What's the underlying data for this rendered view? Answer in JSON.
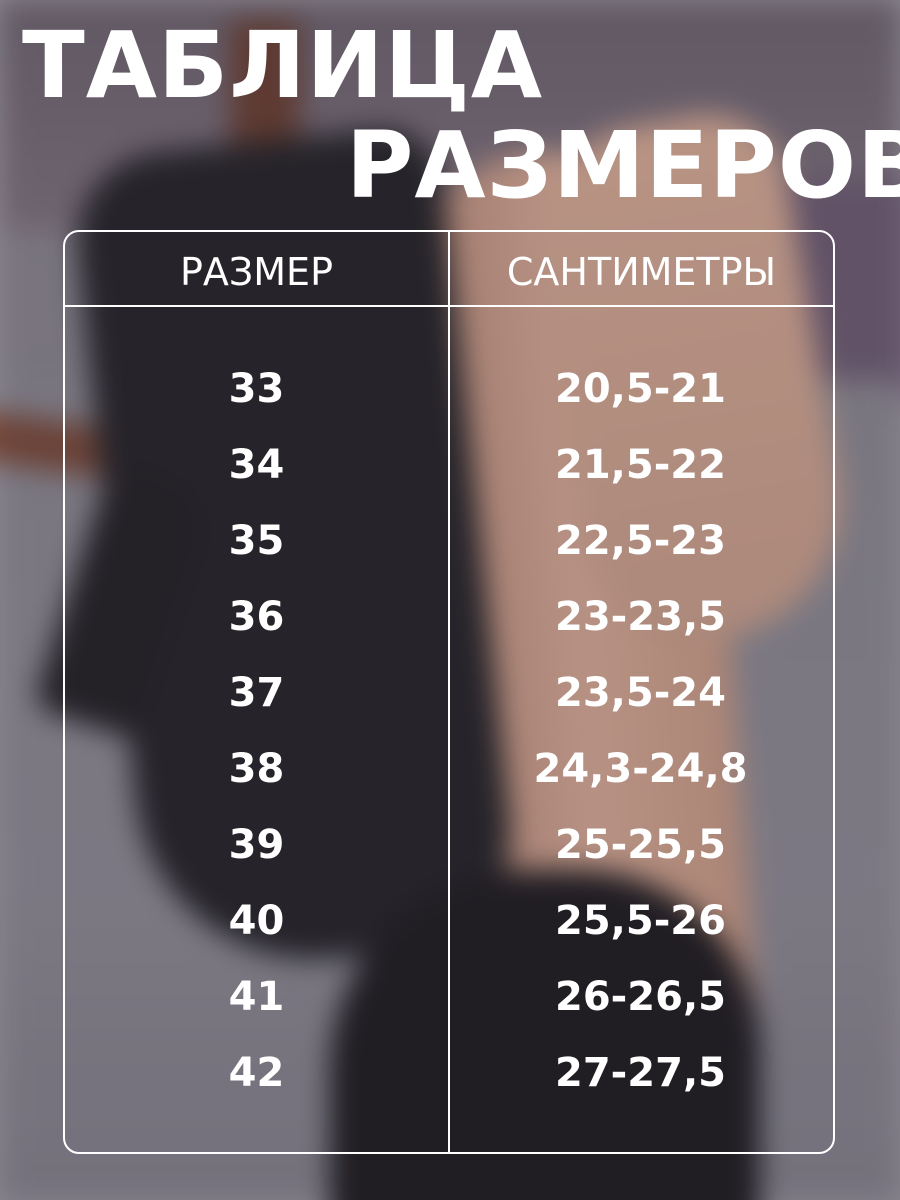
{
  "title": {
    "line1": "ТАБЛИЦА",
    "line2": "РАЗМЕРОВ"
  },
  "table": {
    "headers": {
      "size": "РАЗМЕР",
      "cm": "САНТИМЕТРЫ"
    },
    "rows": [
      {
        "size": "33",
        "cm": "20,5-21"
      },
      {
        "size": "34",
        "cm": "21,5-22"
      },
      {
        "size": "35",
        "cm": "22,5-23"
      },
      {
        "size": "36",
        "cm": "23-23,5"
      },
      {
        "size": "37",
        "cm": "23,5-24"
      },
      {
        "size": "38",
        "cm": "24,3-24,8"
      },
      {
        "size": "39",
        "cm": "25-25,5"
      },
      {
        "size": "40",
        "cm": "25,5-26"
      },
      {
        "size": "41",
        "cm": "26-26,5"
      },
      {
        "size": "42",
        "cm": "27-27,5"
      }
    ]
  },
  "colors": {
    "text": "#ffffff",
    "lines": "#ffffff",
    "background": "#8b8791"
  }
}
